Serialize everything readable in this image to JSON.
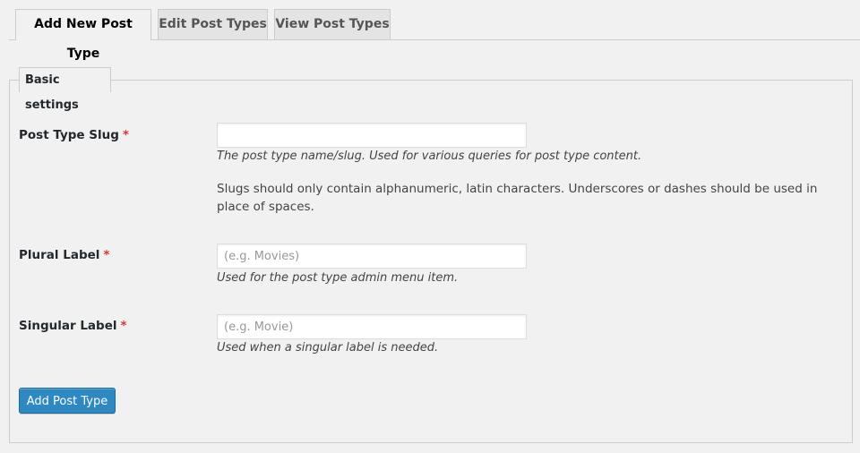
{
  "tabs": [
    {
      "label": "Add New Post Type",
      "active": true
    },
    {
      "label": "Edit Post Types",
      "active": false
    },
    {
      "label": "View Post Types",
      "active": false
    }
  ],
  "section": {
    "legend": "Basic settings"
  },
  "fields": {
    "slug": {
      "label": "Post Type Slug",
      "required_mark": "*",
      "value": "",
      "placeholder": "",
      "description": "The post type name/slug. Used for various queries for post type content.",
      "note": "Slugs should only contain alphanumeric, latin characters. Underscores or dashes should be used in place of spaces."
    },
    "plural": {
      "label": "Plural Label",
      "required_mark": "*",
      "value": "",
      "placeholder": "(e.g. Movies)",
      "description": "Used for the post type admin menu item."
    },
    "singular": {
      "label": "Singular Label",
      "required_mark": "*",
      "value": "",
      "placeholder": "(e.g. Movie)",
      "description": "Used when a singular label is needed."
    }
  },
  "submit": {
    "label": "Add Post Type"
  },
  "colors": {
    "primary_button": "#2e88c1",
    "required": "#dc3232",
    "background": "#f1f1f1"
  }
}
